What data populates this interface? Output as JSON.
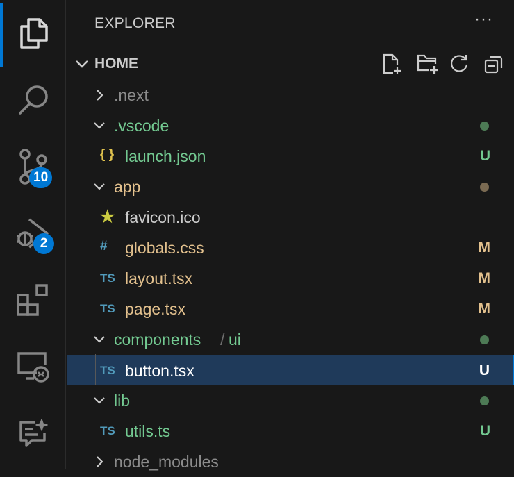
{
  "activity_bar": {
    "scm_badge": "10",
    "debug_badge": "2"
  },
  "explorer": {
    "title": "EXPLORER",
    "more_label": "···",
    "section_title": "HOME",
    "rows": [
      {
        "label": ".next",
        "kind": "folder",
        "expanded": false,
        "color": "#8b8b8b",
        "status": "",
        "dot": ""
      },
      {
        "label": ".vscode",
        "kind": "folder",
        "expanded": true,
        "color": "#73c991",
        "status": "",
        "dot": "#4d7a55"
      },
      {
        "label": "launch.json",
        "kind": "file",
        "icon": "{ }",
        "icon_color": "#e2c44f",
        "color": "#73c991",
        "status": "U",
        "status_color": "#73c991"
      },
      {
        "label": "app",
        "kind": "folder",
        "expanded": true,
        "color": "#e2c08d",
        "status": "",
        "dot": "#7a6a52"
      },
      {
        "label": "favicon.ico",
        "kind": "file",
        "icon": "★",
        "icon_color": "#cbcb41",
        "color": "#cccccc",
        "status": ""
      },
      {
        "label": "globals.css",
        "kind": "file",
        "icon": "#",
        "icon_color": "#519aba",
        "color": "#e2c08d",
        "status": "M",
        "status_color": "#e2c08d"
      },
      {
        "label": "layout.tsx",
        "kind": "file",
        "icon": "TS",
        "icon_color": "#519aba",
        "color": "#e2c08d",
        "status": "M",
        "status_color": "#e2c08d"
      },
      {
        "label": "page.tsx",
        "kind": "file",
        "icon": "TS",
        "icon_color": "#519aba",
        "color": "#e2c08d",
        "status": "M",
        "status_color": "#e2c08d"
      },
      {
        "label": "components",
        "label2": "ui",
        "kind": "folder",
        "expanded": true,
        "color": "#73c991",
        "status": "",
        "dot": "#4d7a55"
      },
      {
        "label": "button.tsx",
        "kind": "file",
        "icon": "TS",
        "icon_color": "#519aba",
        "color": "#ffffff",
        "status": "U",
        "status_color": "#ffffff",
        "selected": true
      },
      {
        "label": "lib",
        "kind": "folder",
        "expanded": true,
        "color": "#73c991",
        "status": "",
        "dot": "#4d7a55"
      },
      {
        "label": "utils.ts",
        "kind": "file",
        "icon": "TS",
        "icon_color": "#519aba",
        "color": "#73c991",
        "status": "U",
        "status_color": "#73c991"
      },
      {
        "label": "node_modules",
        "kind": "folder",
        "expanded": false,
        "color": "#8b8b8b",
        "status": "",
        "dot": ""
      }
    ]
  },
  "colors": {
    "accent": "#0078d4",
    "selection_bg": "#1f3a5a",
    "untracked": "#73c991",
    "modified": "#e2c08d"
  }
}
